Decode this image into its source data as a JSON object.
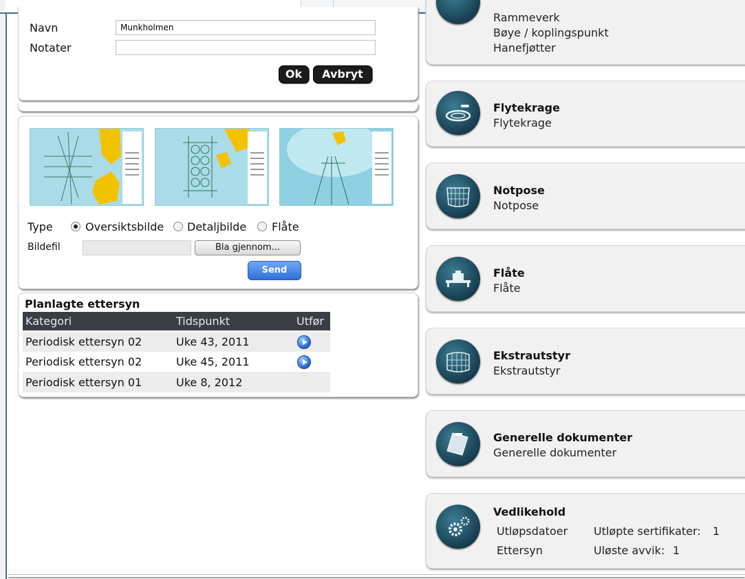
{
  "form": {
    "navn_label": "Navn",
    "navn_value": "Munkholmen",
    "notater_label": "Notater",
    "notater_value": "",
    "ok_label": "Ok",
    "cancel_label": "Avbryt"
  },
  "upload": {
    "type_label": "Type",
    "options": [
      "Oversiktsbilde",
      "Detaljbilde",
      "Flåte"
    ],
    "selected": "Oversiktsbilde",
    "file_label": "Bildefil",
    "browse_label": "Bla gjennom...",
    "send_label": "Send"
  },
  "planned": {
    "title": "Planlagte ettersyn",
    "headers": [
      "Kategori",
      "Tidspunkt",
      "Utfør"
    ],
    "rows": [
      {
        "category": "Periodisk ettersyn 02",
        "time": "Uke 43, 2011",
        "action": true
      },
      {
        "category": "Periodisk ettersyn 02",
        "time": "Uke 45, 2011",
        "action": true
      },
      {
        "category": "Periodisk ettersyn 01",
        "time": "Uke 8, 2012",
        "action": false
      }
    ]
  },
  "cards": {
    "rammeverk": {
      "lines": [
        "Rammeverk",
        "Bøye / koplingspunkt",
        "Hanefjøtter"
      ],
      "icon": "frame-icon"
    },
    "flytekrage": {
      "title": "Flytekrage",
      "subtitle": "Flytekrage",
      "icon": "floating-collar-icon"
    },
    "notpose": {
      "title": "Notpose",
      "subtitle": "Notpose",
      "icon": "net-bag-icon"
    },
    "flate": {
      "title": "Flåte",
      "subtitle": "Flåte",
      "icon": "barge-icon"
    },
    "ekstrautstyr": {
      "title": "Ekstrautstyr",
      "subtitle": "Ekstrautstyr",
      "icon": "extra-equipment-icon"
    },
    "dokumenter": {
      "title": "Generelle dokumenter",
      "subtitle": "Generelle dokumenter",
      "icon": "document-icon"
    },
    "vedlikehold": {
      "title": "Vedlikehold",
      "link1": "Utløpsdatoer",
      "link2": "Ettersyn",
      "cert_label": "Utløpte sertifikater:",
      "cert_count": "1",
      "avvik_label": "Uløste avvik:",
      "avvik_count": "1",
      "icon": "gears-icon"
    }
  },
  "colors": {
    "accent_dark": "#15394a",
    "highlight_red": "#cc1b1b",
    "send_blue": "#2f6fd8"
  }
}
